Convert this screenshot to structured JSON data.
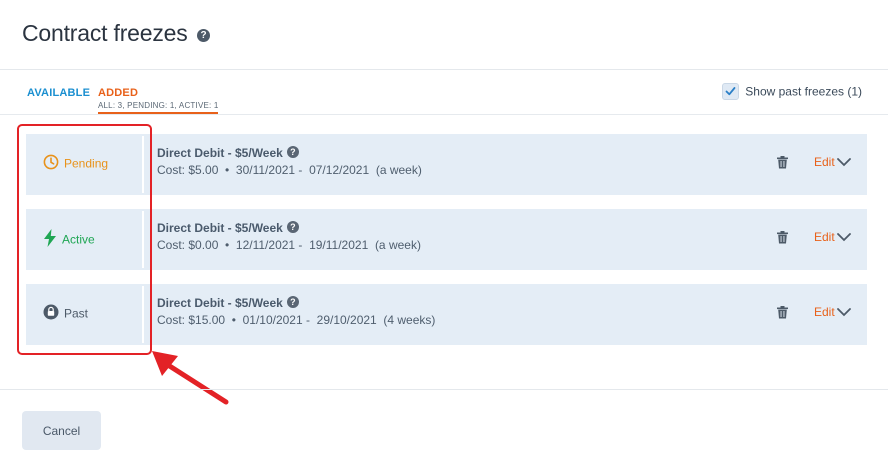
{
  "header": {
    "title": "Contract freezes",
    "help_glyph": "?"
  },
  "tabs": {
    "available_label": "AVAILABLE",
    "added_label": "ADDED",
    "added_counts": "ALL: 3, PENDING: 1, ACTIVE: 1"
  },
  "past_toggle": {
    "label": "Show past freezes (1)",
    "checked": true
  },
  "freezes": [
    {
      "status": "Pending",
      "status_icon": "clock-icon",
      "status_color": "#e8921a",
      "title": "Direct Debit - $5/Week",
      "cost": "Cost: $5.00",
      "dates": "30/11/2021 -  07/12/2021",
      "duration": "(a week)",
      "edit_label": "Edit"
    },
    {
      "status": "Active",
      "status_icon": "lightning-icon",
      "status_color": "#1fa654",
      "title": "Direct Debit - $5/Week",
      "cost": "Cost: $0.00",
      "dates": "12/11/2021 -  19/11/2021",
      "duration": "(a week)",
      "edit_label": "Edit"
    },
    {
      "status": "Past",
      "status_icon": "lock-icon",
      "status_color": "#4d5a68",
      "title": "Direct Debit - $5/Week",
      "cost": "Cost: $15.00",
      "dates": "01/10/2021 -  29/10/2021",
      "duration": "(4 weeks)",
      "edit_label": "Edit"
    }
  ],
  "footer": {
    "cancel_label": "Cancel"
  },
  "colors": {
    "accent_orange": "#e8611a",
    "accent_blue": "#1b8fd0",
    "annotation_red": "#e32226"
  }
}
